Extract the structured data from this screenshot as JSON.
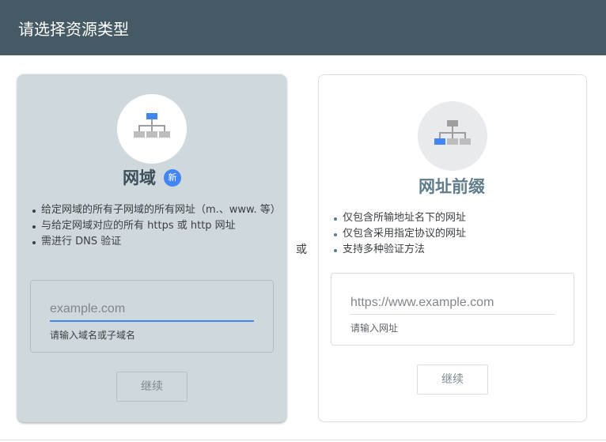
{
  "header": {
    "title": "请选择资源类型"
  },
  "domain_card": {
    "title": "网域",
    "badge": "新",
    "icon": "sitemap-icon",
    "features": [
      "给定网域的所有子网域的所有网址（m.、www. 等）",
      "与给定网域对应的所有 https 或 http 网址",
      "需进行 DNS 验证"
    ],
    "input_placeholder": "example.com",
    "input_value": "",
    "input_hint": "请输入域名或子域名",
    "continue_label": "继续"
  },
  "separator": {
    "label": "或"
  },
  "prefix_card": {
    "title": "网址前缀",
    "icon": "sitemap-icon",
    "features": [
      "仅包含所输地址名下的网址",
      "仅包含采用指定协议的网址",
      "支持多种验证方法"
    ],
    "input_placeholder": "https://www.example.com",
    "input_value": "",
    "input_hint": "请输入网址",
    "continue_label": "继续"
  },
  "colors": {
    "header_bg": "#455a64",
    "selected_card_bg": "#cfd8dc",
    "accent": "#4285f4"
  }
}
